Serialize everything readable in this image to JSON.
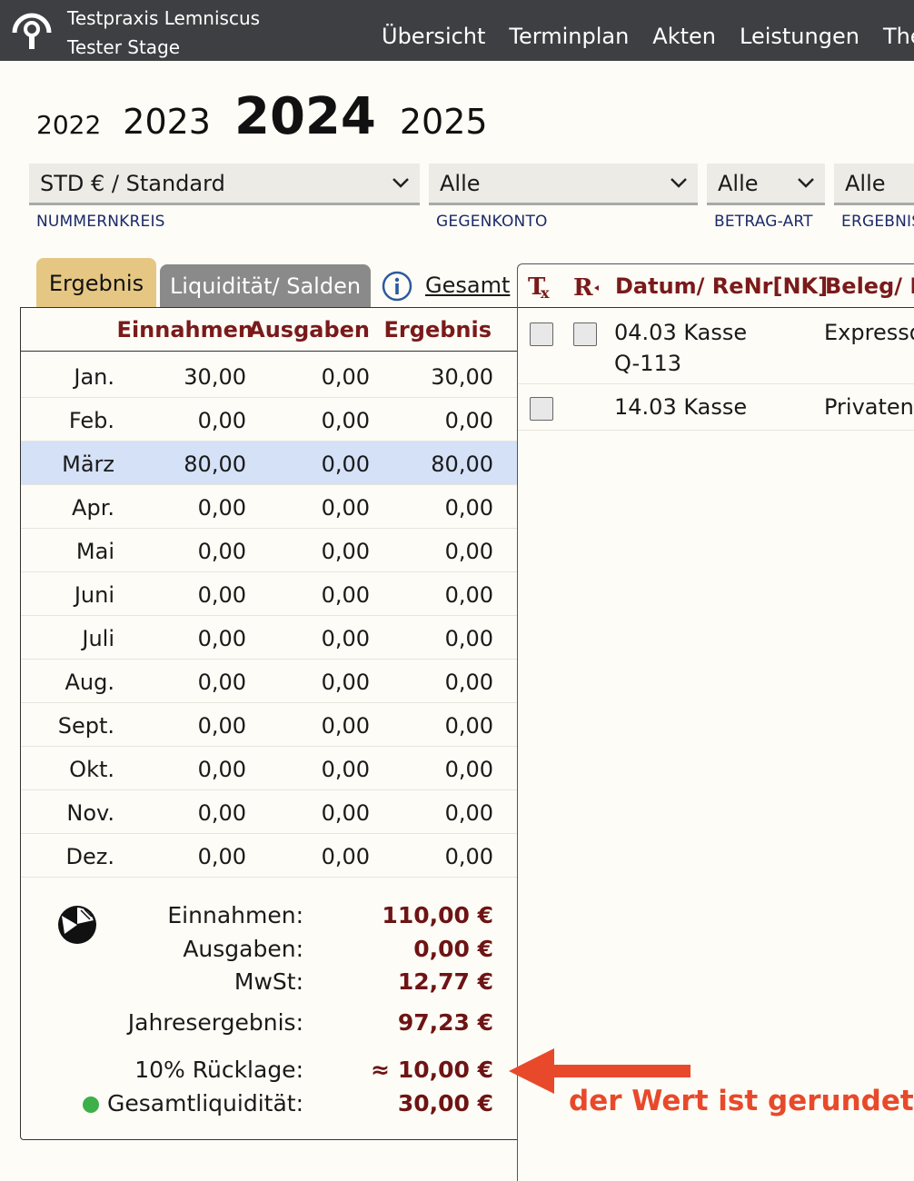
{
  "app": {
    "practice_name": "Testpraxis Lemniscus",
    "practice_stage": "Tester Stage",
    "nav": [
      "Übersicht",
      "Terminplan",
      "Akten",
      "Leistungen",
      "Ther"
    ]
  },
  "years": [
    "2022",
    "2023",
    "2024",
    "2025"
  ],
  "selected_year": "2024",
  "filters": [
    {
      "value": "STD € / Standard",
      "label": "NUMMERNKREIS"
    },
    {
      "value": "Alle",
      "label": "GEGENKONTO"
    },
    {
      "value": "Alle",
      "label": "BETRAG-ART"
    },
    {
      "value": "Alle",
      "label": "ERGEBNIS"
    }
  ],
  "tabs": {
    "active": "Ergebnis",
    "inactive": "Liquidität/ Salden",
    "link": "Gesamt"
  },
  "table": {
    "headers": {
      "einnahmen": "Einnahmen",
      "ausgaben": "Ausgaben",
      "ergebnis": "Ergebnis"
    },
    "rows": [
      {
        "month": "Jan.",
        "ein": "30,00",
        "aus": "0,00",
        "erg": "30,00"
      },
      {
        "month": "Feb.",
        "ein": "0,00",
        "aus": "0,00",
        "erg": "0,00"
      },
      {
        "month": "März",
        "ein": "80,00",
        "aus": "0,00",
        "erg": "80,00"
      },
      {
        "month": "Apr.",
        "ein": "0,00",
        "aus": "0,00",
        "erg": "0,00"
      },
      {
        "month": "Mai",
        "ein": "0,00",
        "aus": "0,00",
        "erg": "0,00"
      },
      {
        "month": "Juni",
        "ein": "0,00",
        "aus": "0,00",
        "erg": "0,00"
      },
      {
        "month": "Juli",
        "ein": "0,00",
        "aus": "0,00",
        "erg": "0,00"
      },
      {
        "month": "Aug.",
        "ein": "0,00",
        "aus": "0,00",
        "erg": "0,00"
      },
      {
        "month": "Sept.",
        "ein": "0,00",
        "aus": "0,00",
        "erg": "0,00"
      },
      {
        "month": "Okt.",
        "ein": "0,00",
        "aus": "0,00",
        "erg": "0,00"
      },
      {
        "month": "Nov.",
        "ein": "0,00",
        "aus": "0,00",
        "erg": "0,00"
      },
      {
        "month": "Dez.",
        "ein": "0,00",
        "aus": "0,00",
        "erg": "0,00"
      }
    ],
    "selected_month": "März"
  },
  "summary": {
    "einnahmen_label": "Einnahmen:",
    "einnahmen": "110,00 €",
    "ausgaben_label": "Ausgaben:",
    "ausgaben": "0,00 €",
    "mwst_label": "MwSt:",
    "mwst": "12,77 €",
    "jahres_label": "Jahresergebnis:",
    "jahres": "97,23 €",
    "ruecklage_label": "10% Rücklage:",
    "ruecklage": "≈ 10,00 €",
    "liquiditaet_label": "Gesamtliquidität:",
    "liquiditaet": "30,00 €",
    "liquiditaet_status_color": "#3db04a"
  },
  "entries": {
    "headers": {
      "datum": "Datum/ ReNr[NK]",
      "beleg": "Beleg/ K"
    },
    "rows": [
      {
        "line1": "04.03 Kasse",
        "line2": "Q-113",
        "beleg": "Expressq"
      },
      {
        "line1": "14.03 Kasse",
        "line2": "",
        "beleg": "Privatent"
      }
    ]
  },
  "annotation": "der Wert ist gerundet",
  "colors": {
    "topbar": "#3d3f42",
    "accent_dark_red": "#7a1a1a",
    "tab_active": "#e5c783",
    "selected_row": "#d4e1f7",
    "annotation": "#e8492b"
  }
}
